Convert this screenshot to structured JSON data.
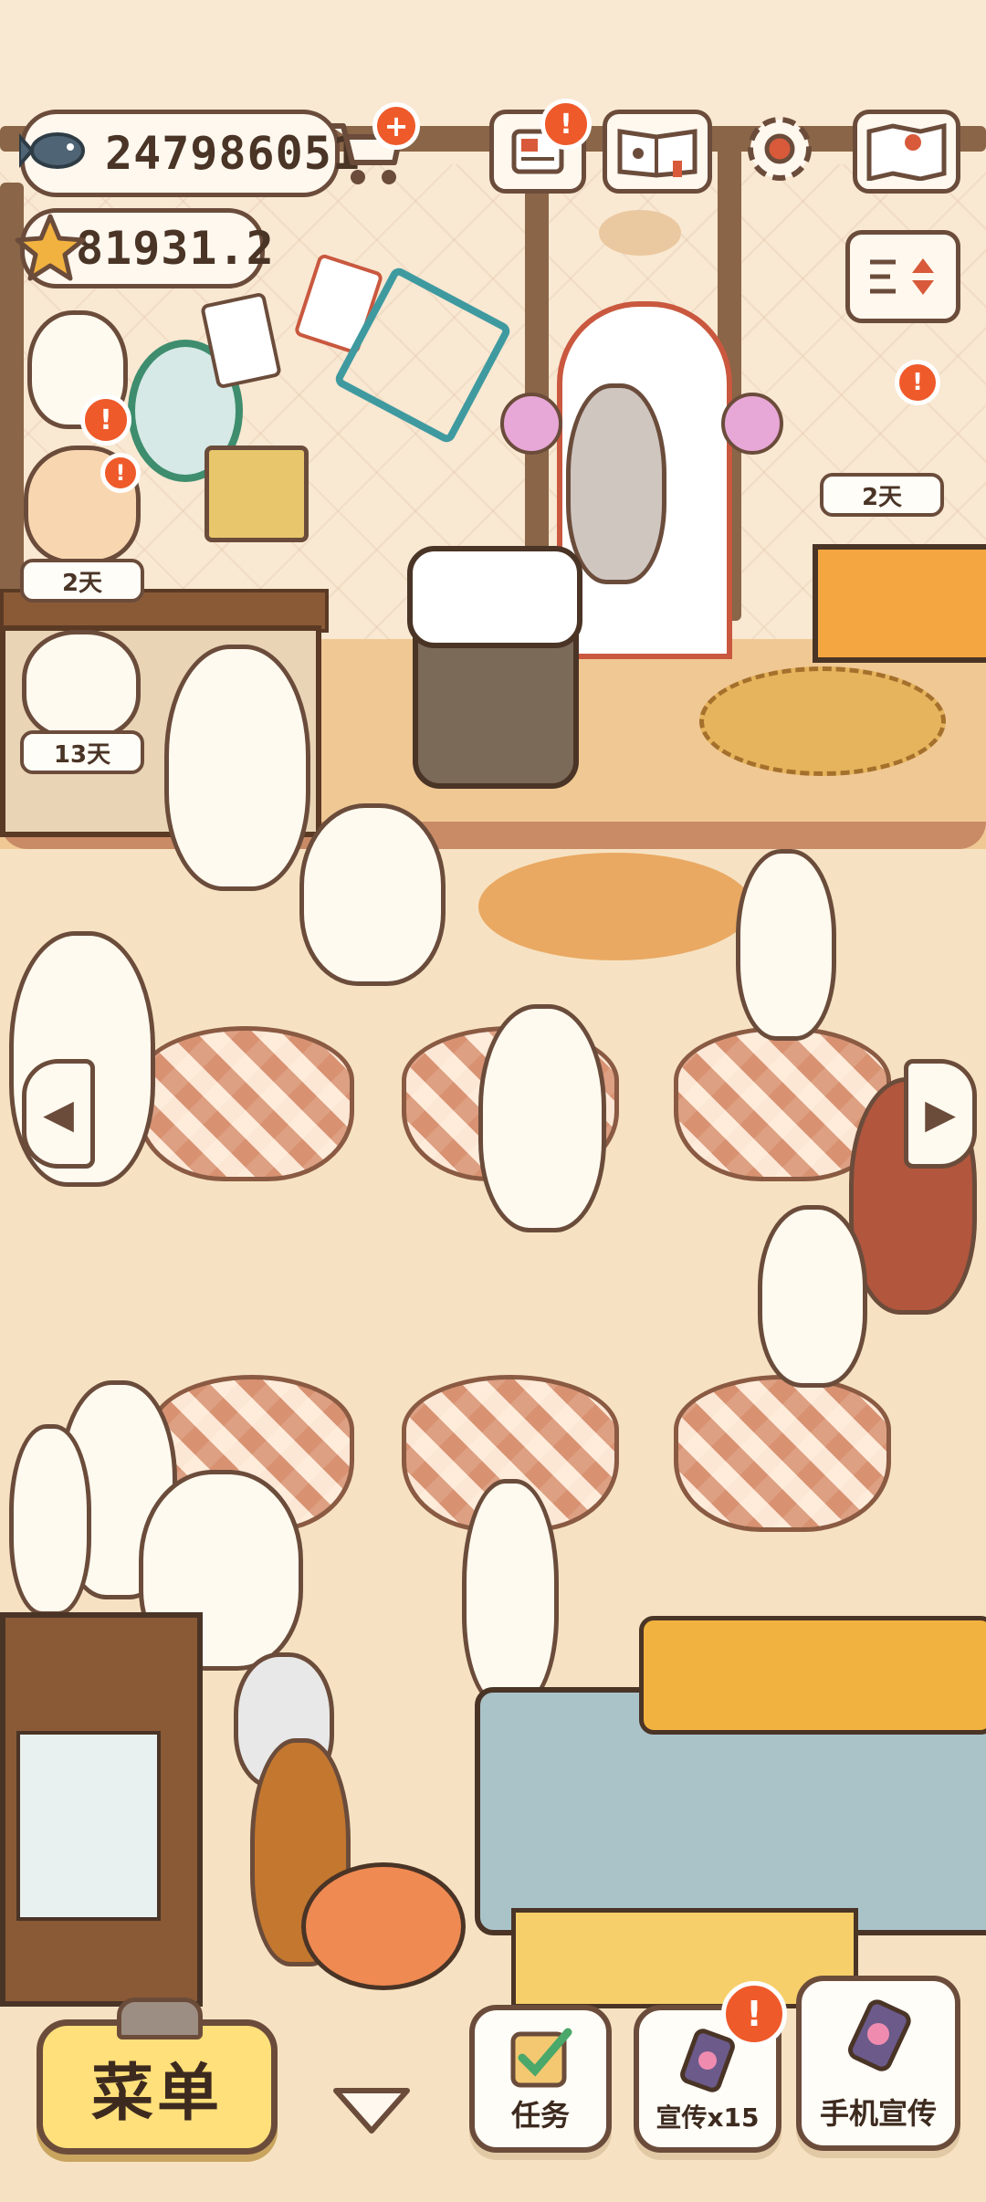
{
  "hud": {
    "fish_amount": "247986051",
    "star_amount": "81931.2",
    "fish_icon": "fish-icon",
    "star_icon": "star-icon",
    "shop_cart_badge": "+",
    "notice_badge": "!",
    "guide_icon": "paw-book-icon",
    "settings_icon": "gear-icon",
    "map_icon": "map-icon",
    "layout_toggle_icon": "sort-toggle-icon"
  },
  "timers": {
    "left_top": "2天",
    "left_bottom": "13天",
    "right_top": "2天"
  },
  "alerts": {
    "cat_alert": "!",
    "mask_alert": "!",
    "right_cat_alert": "!",
    "promo_alert": "!"
  },
  "bottom_bar": {
    "menu_label": "菜单",
    "down_icon": "chevron-down-icon",
    "tasks_label": "任务",
    "promo_label": "宣传x15",
    "phone_promo_label": "手机宣传"
  },
  "colors": {
    "wall": "#f9e8d2",
    "floor": "#f6e2c2",
    "outline": "#6b4c3b",
    "accent_badge": "#ef5a2b",
    "menu_yellow": "#ffe07a"
  }
}
